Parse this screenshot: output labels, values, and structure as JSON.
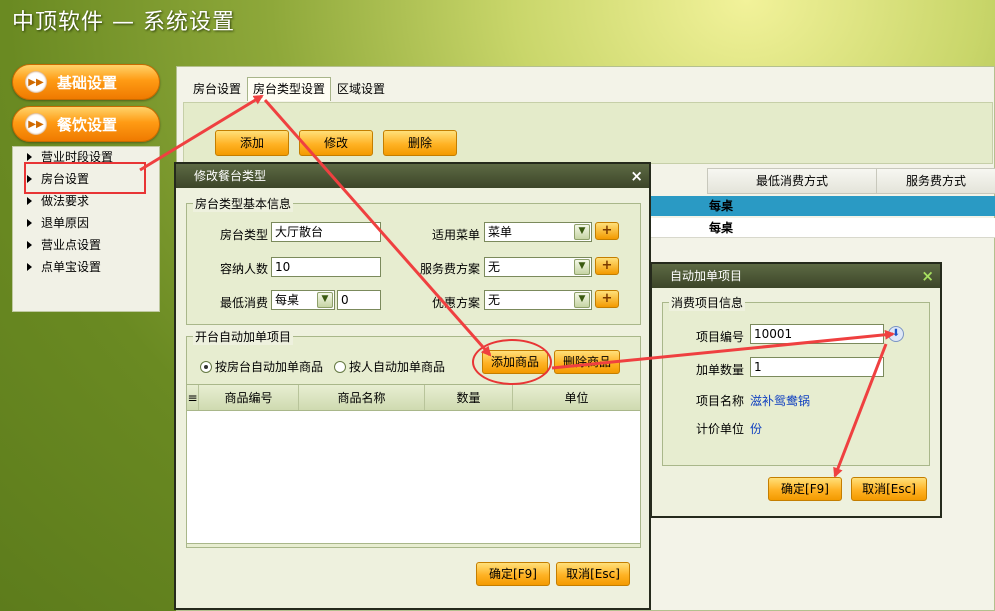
{
  "app": {
    "title": "中顶软件 — 系统设置"
  },
  "nav": {
    "basic_settings": "基础设置",
    "dining_settings": "餐饮设置",
    "sub_items": [
      "营业时段设置",
      "房台设置",
      "做法要求",
      "退单原因",
      "营业点设置",
      "点单宝设置"
    ]
  },
  "main": {
    "tabs": [
      "房台设置",
      "房台类型设置",
      "区域设置"
    ],
    "toolbar": {
      "add": "添加",
      "edit": "修改",
      "delete": "删除"
    },
    "columns": [
      "最低消费方式",
      "服务费方式"
    ],
    "rows": [
      "每桌",
      "每桌"
    ]
  },
  "dialog_edit": {
    "title": "修改餐台类型",
    "group_basic": "房台类型基本信息",
    "room_type_label": "房台类型",
    "room_type_value": "大厅散台",
    "capacity_label": "容纳人数",
    "capacity_value": "10",
    "min_consume_label": "最低消费",
    "min_consume_mode": "每桌",
    "min_consume_value": "0",
    "menu_label": "适用菜单",
    "menu_value": "菜单",
    "service_label": "服务费方案",
    "service_value": "无",
    "discount_label": "优惠方案",
    "discount_value": "无",
    "group_auto": "开台自动加单项目",
    "radio_room": "按房台自动加单商品",
    "radio_person": "按人自动加单商品",
    "add_goods": "添加商品",
    "delete_goods": "删除商品",
    "columns": [
      "商品编号",
      "商品名称",
      "数量",
      "单位"
    ],
    "ok": "确定[F9]",
    "cancel": "取消[Esc]"
  },
  "dialog_auto": {
    "title": "自动加单项目",
    "group": "消费项目信息",
    "code_label": "项目编号",
    "code_value": "10001",
    "qty_label": "加单数量",
    "qty_value": "1",
    "name_label": "项目名称",
    "name_value": "滋补鸳鸯锅",
    "unit_label": "计价单位",
    "unit_value": "份",
    "ok": "确定[F9]",
    "cancel": "取消[Esc]"
  },
  "colors": {
    "accent_orange": "#f39a00",
    "highlight_red": "#e83535",
    "title_bar": "#3c4528"
  }
}
